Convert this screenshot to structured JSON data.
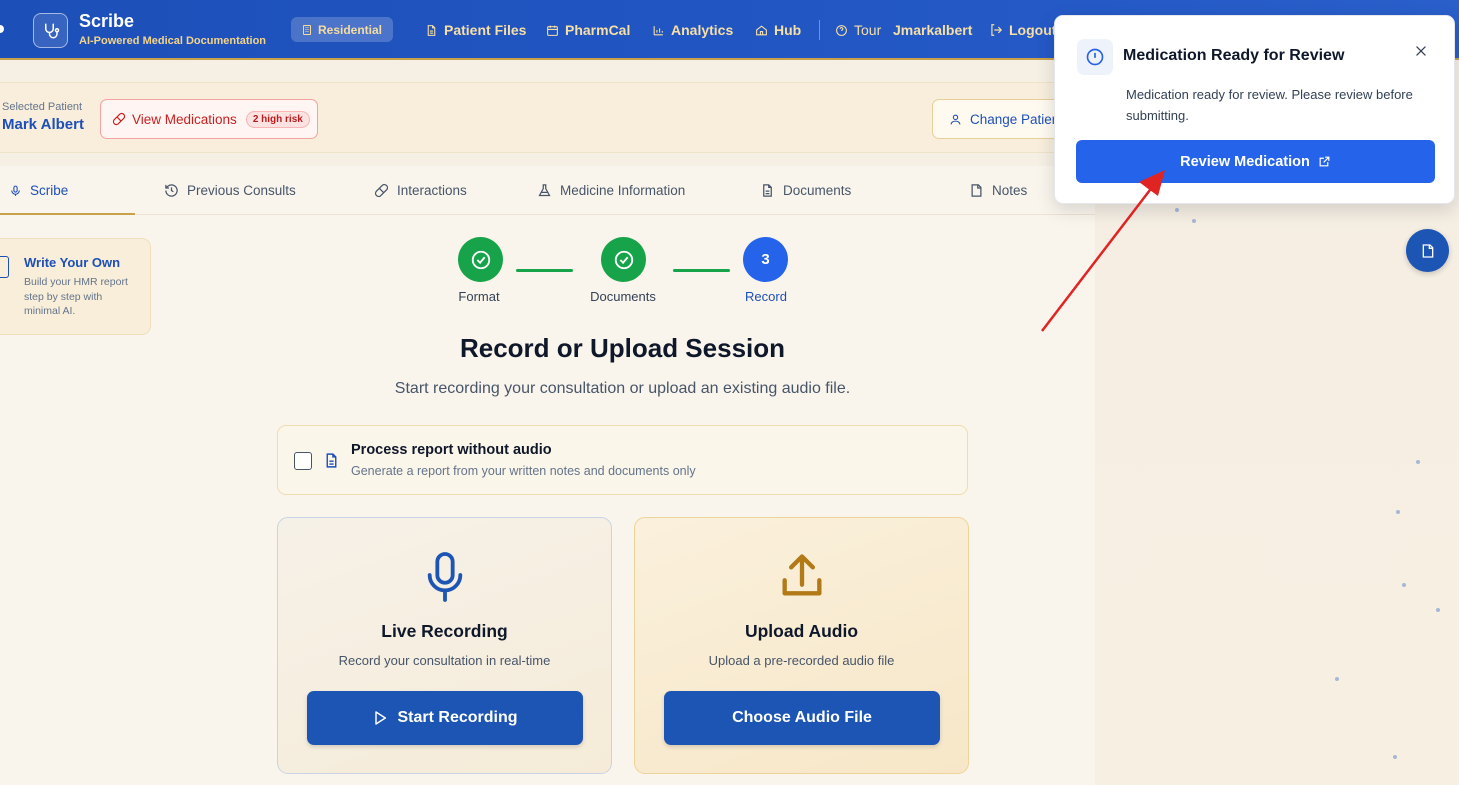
{
  "header": {
    "brand_name": "Scribe",
    "brand_sub": "AI-Powered Medical Documentation",
    "residential_label": "Residential",
    "nav": {
      "patient_files": "Patient Files",
      "pharmcal": "PharmCal",
      "analytics": "Analytics",
      "hub": "Hub",
      "tour": "Tour",
      "user": "Jmarkalbert",
      "logout": "Logout"
    }
  },
  "patient": {
    "label": "Selected Patient",
    "name": "Mark Albert",
    "view_meds_label": "View Medications",
    "risk_badge": "2 high risk",
    "change_patient_label": "Change Patient"
  },
  "tabs": {
    "scribe": "Scribe",
    "previous_consults": "Previous Consults",
    "interactions": "Interactions",
    "medicine_information": "Medicine Information",
    "documents": "Documents",
    "notes": "Notes"
  },
  "side_card": {
    "title": "Write Your Own",
    "description": "Build your HMR report step by step with minimal AI."
  },
  "stepper": {
    "steps": [
      {
        "label": "Format",
        "status": "done"
      },
      {
        "label": "Documents",
        "status": "done"
      },
      {
        "label": "Record",
        "status": "current",
        "number": "3"
      }
    ]
  },
  "main": {
    "title": "Record or Upload Session",
    "subtitle": "Start recording your consultation or upload an existing audio file.",
    "no_audio_title": "Process report without audio",
    "no_audio_desc": "Generate a report from your written notes and documents only",
    "no_audio_checked": false,
    "live": {
      "title": "Live Recording",
      "desc": "Record your consultation in real-time",
      "button": "Start Recording",
      "icon": "microphone-icon"
    },
    "upload": {
      "title": "Upload Audio",
      "desc": "Upload a pre-recorded audio file",
      "button": "Choose Audio File",
      "icon": "upload-icon"
    }
  },
  "notification": {
    "title": "Medication Ready for Review",
    "message": "Medication ready for review. Please review before submitting.",
    "button": "Review Medication"
  },
  "colors": {
    "primary": "#1d55b5",
    "accent_gold": "#c9a14a",
    "success": "#16a34a",
    "danger": "#c81e1e",
    "annotation_arrow": "#e02424"
  }
}
